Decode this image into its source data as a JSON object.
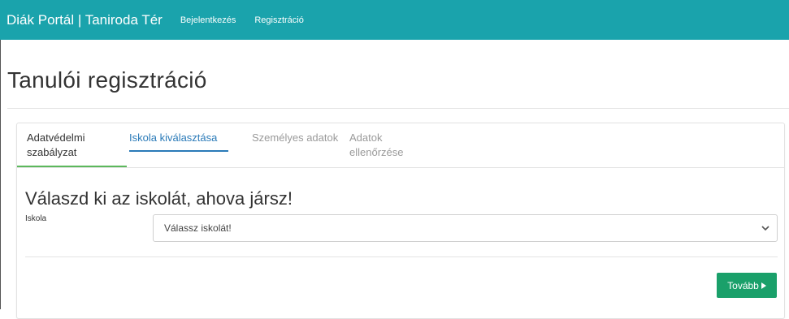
{
  "navbar": {
    "brand": "Diák Portál | Taniroda Tér",
    "links": [
      "Bejelentkezés",
      "Regisztráció"
    ]
  },
  "page": {
    "title": "Tanulói regisztráció"
  },
  "wizard": {
    "tabs": [
      {
        "label": "Adatvédelmi szabályzat",
        "state": "completed"
      },
      {
        "label": "Iskola kiválasztása",
        "state": "active"
      },
      {
        "label": "Személyes adatok",
        "state": "disabled"
      },
      {
        "label": "Adatok ellenőrzése",
        "state": "disabled"
      }
    ],
    "step_heading": "Válaszd ki az iskolát, ahova jársz!",
    "school_field": {
      "label": "Iskola",
      "selected": "Válassz iskolát!"
    },
    "next_label": "Tovább"
  },
  "colors": {
    "navbar": "#1aa3ac",
    "active_tab": "#2a7ab8",
    "completed_tab": "#5cb85c",
    "next_button": "#1aa06a"
  },
  "icons": {
    "select": "chevron-down-icon",
    "next": "caret-right-icon"
  }
}
